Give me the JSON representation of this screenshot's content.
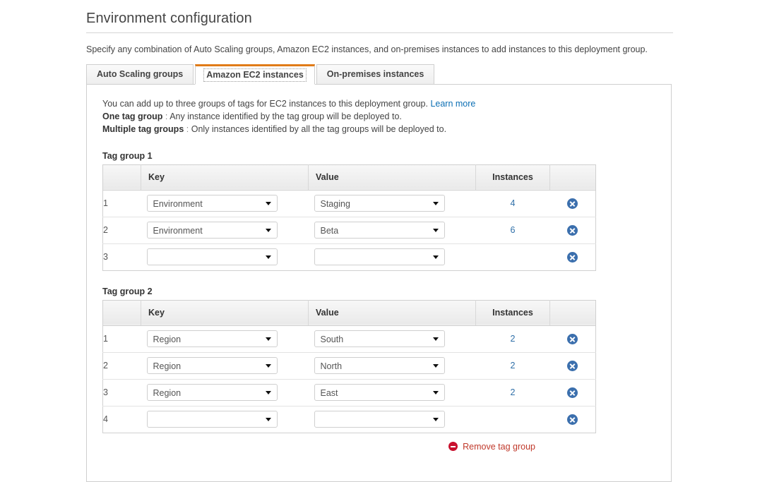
{
  "page": {
    "title": "Environment configuration",
    "intro": "Specify any combination of Auto Scaling groups, Amazon EC2 instances, and on-premises instances to add instances to this deployment group."
  },
  "tabs": [
    {
      "label": "Auto Scaling groups",
      "active": false
    },
    {
      "label": "Amazon EC2 instances",
      "active": true
    },
    {
      "label": "On-premises instances",
      "active": false
    }
  ],
  "help": {
    "line1": "You can add up to three groups of tags for EC2 instances to this deployment group.",
    "learn_more": "Learn more",
    "line2_label": "One tag group",
    "line2_sep": ":",
    "line2_text": "Any instance identified by the tag group will be deployed to.",
    "line3_label": "Multiple tag groups",
    "line3_sep": ":",
    "line3_text": "Only instances identified by all the tag groups will be deployed to."
  },
  "columns": {
    "num": "",
    "key": "Key",
    "value": "Value",
    "instances": "Instances",
    "delete": ""
  },
  "groups": [
    {
      "title": "Tag group 1",
      "rows": [
        {
          "num": "1",
          "key": "Environment",
          "value": "Staging",
          "instances": "4"
        },
        {
          "num": "2",
          "key": "Environment",
          "value": "Beta",
          "instances": "6"
        },
        {
          "num": "3",
          "key": "",
          "value": "",
          "instances": ""
        }
      ]
    },
    {
      "title": "Tag group 2",
      "rows": [
        {
          "num": "1",
          "key": "Region",
          "value": "South",
          "instances": "2"
        },
        {
          "num": "2",
          "key": "Region",
          "value": "North",
          "instances": "2"
        },
        {
          "num": "3",
          "key": "Region",
          "value": "East",
          "instances": "2"
        },
        {
          "num": "4",
          "key": "",
          "value": "",
          "instances": ""
        }
      ]
    }
  ],
  "actions": {
    "remove_tag_group": "Remove tag group"
  },
  "colors": {
    "accent_orange": "#e07b18",
    "link_blue": "#0c6fb4",
    "instance_link": "#2f6fa8",
    "danger_red": "#c8102e",
    "delete_icon_blue": "#3b6fad"
  }
}
